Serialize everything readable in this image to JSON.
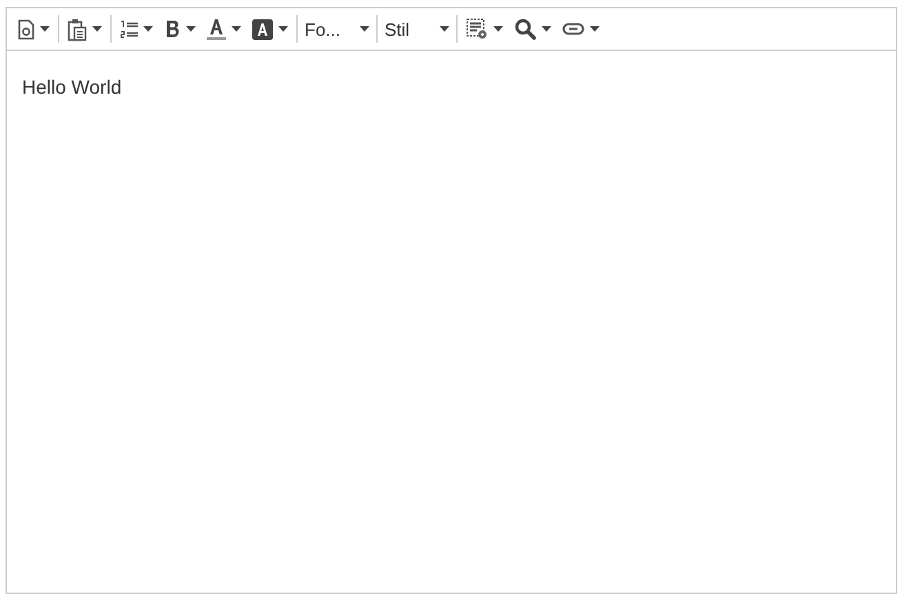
{
  "toolbar": {
    "groups": [
      {
        "items": [
          {
            "kind": "menu-button"
          }
        ]
      },
      {
        "items": [
          {
            "kind": "menu-button"
          }
        ]
      },
      {
        "items": [
          {
            "kind": "menu-button"
          },
          {
            "kind": "menu-button"
          },
          {
            "kind": "menu-button"
          },
          {
            "kind": "menu-button"
          }
        ]
      },
      {
        "items": [
          {
            "kind": "combo",
            "label": "Fo..."
          }
        ]
      },
      {
        "items": [
          {
            "kind": "combo",
            "label": "Stil"
          }
        ]
      },
      {
        "items": [
          {
            "kind": "menu-button"
          },
          {
            "kind": "menu-button"
          },
          {
            "kind": "menu-button"
          }
        ]
      }
    ]
  },
  "editor": {
    "content": "Hello World"
  }
}
